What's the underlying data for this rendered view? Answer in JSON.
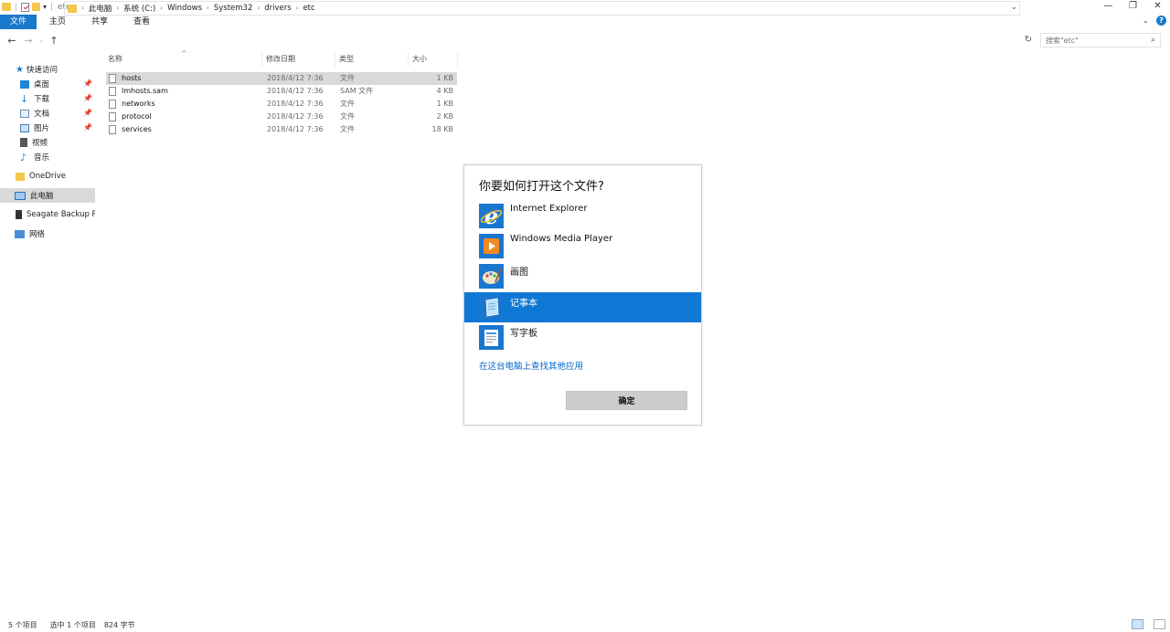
{
  "window": {
    "title": "etc"
  },
  "ribbon": {
    "tabs": [
      "文件",
      "主页",
      "共享",
      "查看"
    ]
  },
  "address": {
    "crumbs": [
      "此电脑",
      "系统 (C:)",
      "Windows",
      "System32",
      "drivers",
      "etc"
    ],
    "search_placeholder": "搜索\"etc\""
  },
  "sidebar": {
    "items": [
      {
        "label": "快速访问",
        "icon": "star-icon"
      },
      {
        "label": "桌面",
        "icon": "desktop-icon",
        "pinned": true
      },
      {
        "label": "下载",
        "icon": "download-icon",
        "pinned": true
      },
      {
        "label": "文档",
        "icon": "document-icon",
        "pinned": true
      },
      {
        "label": "图片",
        "icon": "picture-icon",
        "pinned": true
      },
      {
        "label": "视频",
        "icon": "video-icon"
      },
      {
        "label": "音乐",
        "icon": "music-icon"
      },
      {
        "label": "OneDrive",
        "icon": "folder-icon"
      },
      {
        "label": "此电脑",
        "icon": "computer-icon",
        "selected": true
      },
      {
        "label": "Seagate Backup Plu",
        "icon": "drive-icon"
      },
      {
        "label": "网络",
        "icon": "network-icon"
      }
    ]
  },
  "columns": {
    "name": "名称",
    "date": "修改日期",
    "type": "类型",
    "size": "大小"
  },
  "files": [
    {
      "name": "hosts",
      "date": "2018/4/12 7:36",
      "type": "文件",
      "size": "1 KB",
      "selected": true
    },
    {
      "name": "lmhosts.sam",
      "date": "2018/4/12 7:36",
      "type": "SAM 文件",
      "size": "4 KB"
    },
    {
      "name": "networks",
      "date": "2018/4/12 7:36",
      "type": "文件",
      "size": "1 KB"
    },
    {
      "name": "protocol",
      "date": "2018/4/12 7:36",
      "type": "文件",
      "size": "2 KB"
    },
    {
      "name": "services",
      "date": "2018/4/12 7:36",
      "type": "文件",
      "size": "18 KB"
    }
  ],
  "dialog": {
    "title": "你要如何打开这个文件?",
    "apps": [
      {
        "label": "Internet Explorer",
        "icon": "internet-explorer-icon"
      },
      {
        "label": "Windows Media Player",
        "icon": "media-player-icon"
      },
      {
        "label": "画图",
        "icon": "paint-icon"
      },
      {
        "label": "记事本",
        "icon": "notepad-icon",
        "selected": true
      },
      {
        "label": "写字板",
        "icon": "wordpad-icon"
      }
    ],
    "more_link": "在这台电脑上查找其他应用",
    "ok_label": "确定"
  },
  "status": {
    "count": "5 个项目",
    "selection": "选中 1 个项目",
    "size": "824 字节"
  },
  "colors": {
    "accent": "#1979ca",
    "selected_row": "#d9d9d9",
    "dialog_selected": "#0f78d4"
  }
}
